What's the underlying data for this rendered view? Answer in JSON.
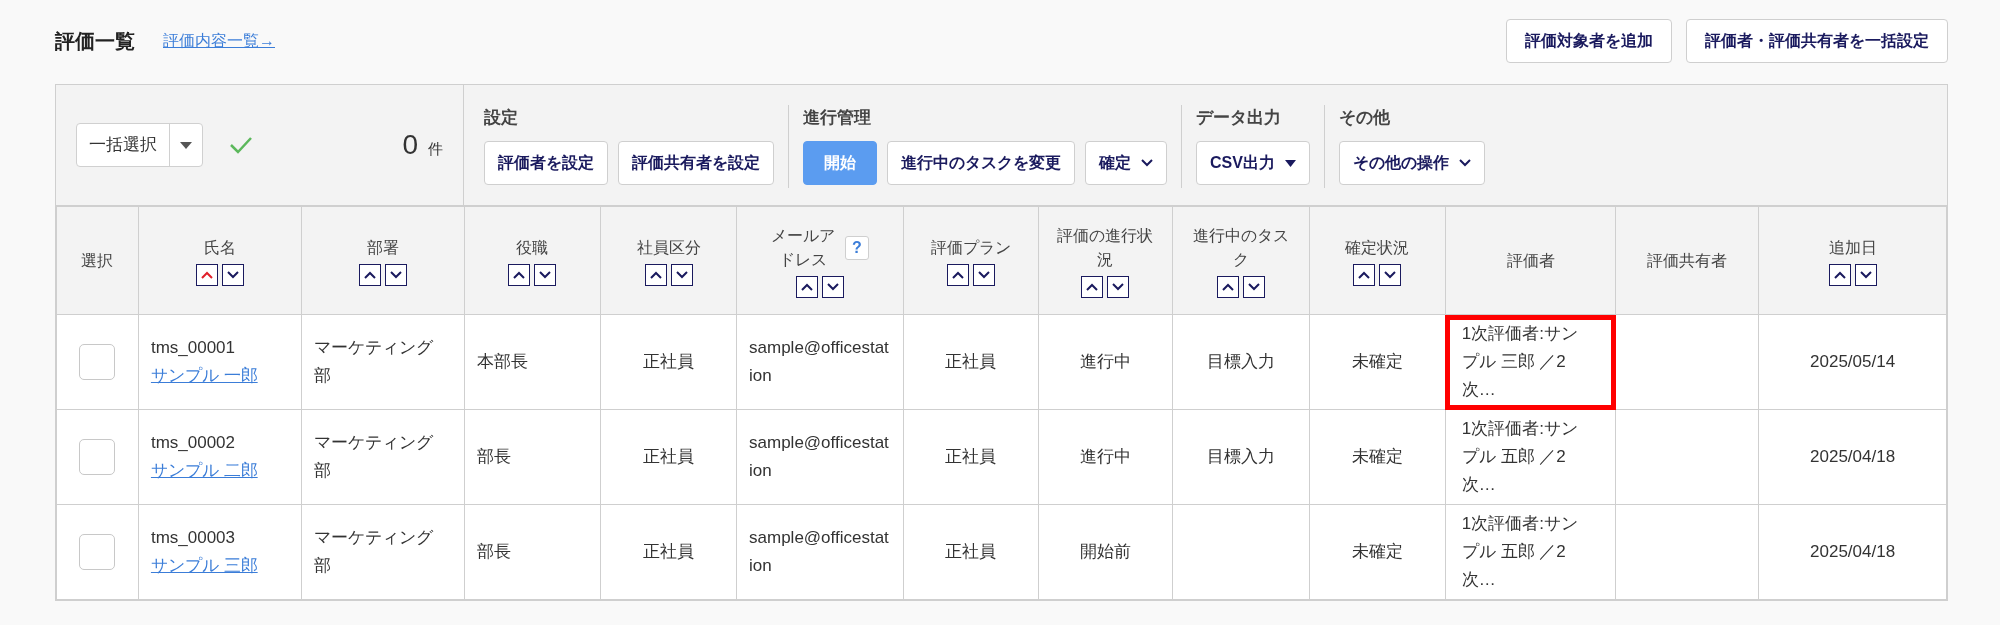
{
  "page": {
    "title": "評価一覧",
    "link": "評価内容一覧→"
  },
  "header_buttons": [
    "評価対象者を追加",
    "評価者・評価共有者を一括設定"
  ],
  "toolbar": {
    "bulk_select": "一括選択",
    "count": "0",
    "count_unit": "件",
    "groups": [
      {
        "label": "設定",
        "buttons": [
          {
            "label": "評価者を設定",
            "kind": "plain"
          },
          {
            "label": "評価共有者を設定",
            "kind": "plain"
          }
        ]
      },
      {
        "label": "進行管理",
        "buttons": [
          {
            "label": "開始",
            "kind": "primary"
          },
          {
            "label": "進行中のタスクを変更",
            "kind": "plain"
          },
          {
            "label": "確定",
            "kind": "chevron"
          }
        ]
      },
      {
        "label": "データ出力",
        "buttons": [
          {
            "label": "CSV出力",
            "kind": "caret"
          }
        ]
      },
      {
        "label": "その他",
        "buttons": [
          {
            "label": "その他の操作",
            "kind": "chevron"
          }
        ]
      }
    ]
  },
  "table": {
    "columns": [
      {
        "label": "選択",
        "sortable": false
      },
      {
        "label": "氏名",
        "sortable": true,
        "ascending_active": true
      },
      {
        "label": "部署",
        "sortable": true,
        "ascending_active": false
      },
      {
        "label": "役職",
        "sortable": true,
        "ascending_active": false
      },
      {
        "label": "社員区分",
        "sortable": true,
        "ascending_active": false
      },
      {
        "label": "メールアドレス",
        "sortable": true,
        "ascending_active": false,
        "help": "?"
      },
      {
        "label": "評価プラン",
        "sortable": true,
        "ascending_active": false
      },
      {
        "label": "評価の進行状況",
        "sortable": true,
        "ascending_active": false
      },
      {
        "label": "進行中のタスク",
        "sortable": true,
        "ascending_active": false
      },
      {
        "label": "確定状況",
        "sortable": true,
        "ascending_active": false
      },
      {
        "label": "評価者",
        "sortable": false
      },
      {
        "label": "評価共有者",
        "sortable": false
      },
      {
        "label": "追加日",
        "sortable": true,
        "ascending_active": false
      }
    ],
    "rows": [
      {
        "checked": false,
        "id": "tms_00001",
        "name": "サンプル 一郎",
        "department": "マーケティング部",
        "position": "本部長",
        "employment": "正社員",
        "email": "sample@officestation",
        "plan": "正社員",
        "progress": "進行中",
        "task": "目標入力",
        "confirmation": "未確定",
        "evaluators": "1次評価者:サンプル 三郎 ／2次…",
        "evaluators_highlighted": true,
        "added": "2025/05/14"
      },
      {
        "checked": false,
        "id": "tms_00002",
        "name": "サンプル 二郎",
        "department": "マーケティング部",
        "position": "部長",
        "employment": "正社員",
        "email": "sample@officestation",
        "plan": "正社員",
        "progress": "進行中",
        "task": "目標入力",
        "confirmation": "未確定",
        "evaluators": "1次評価者:サンプル 五郎 ／2次…",
        "evaluators_highlighted": false,
        "added": "2025/04/18"
      },
      {
        "checked": false,
        "id": "tms_00003",
        "name": "サンプル 三郎",
        "department": "マーケティング部",
        "position": "部長",
        "employment": "正社員",
        "email": "sample@officestation",
        "plan": "正社員",
        "progress": "開始前",
        "confirmation": "未確定",
        "evaluators": "1次評価者:サンプル 五郎 ／2次…",
        "evaluators_highlighted": false,
        "added": "2025/04/18"
      }
    ]
  }
}
